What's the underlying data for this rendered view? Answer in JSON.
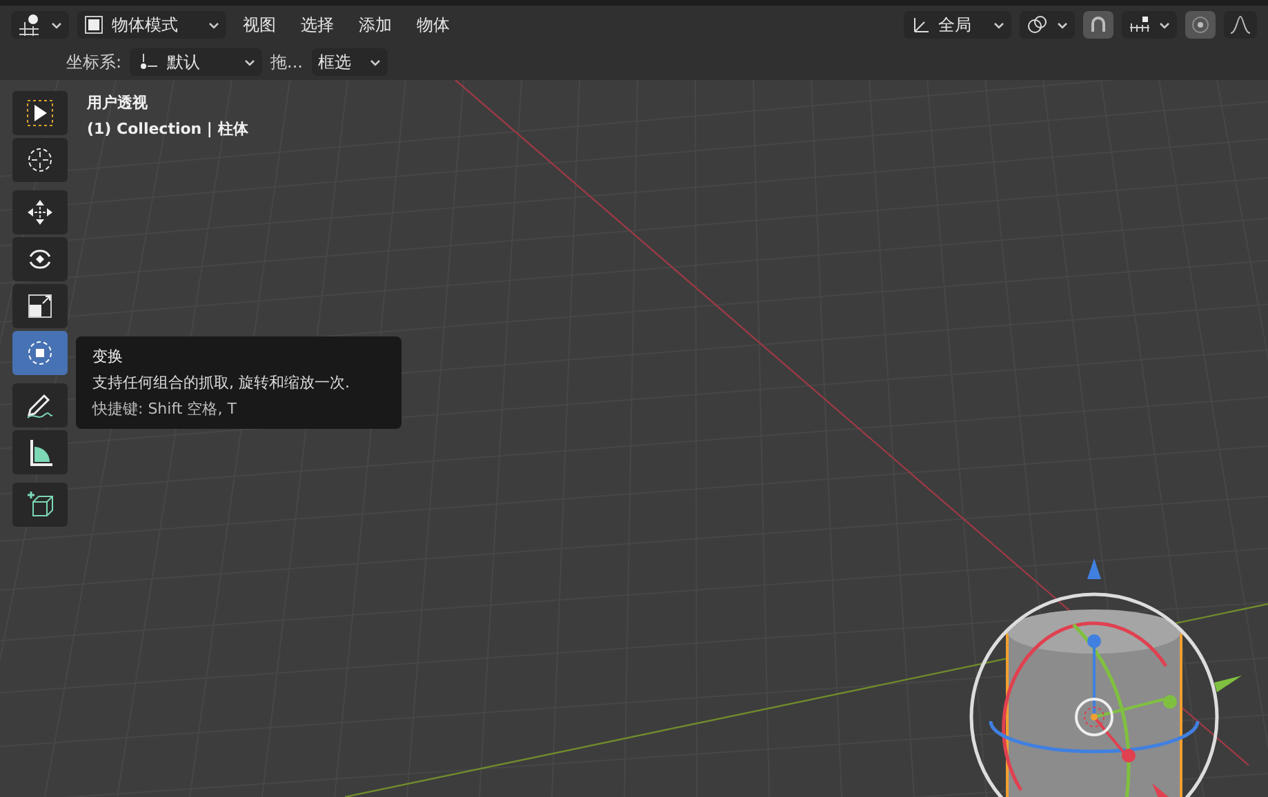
{
  "header": {
    "mode": {
      "label": "物体模式"
    },
    "menus": [
      "视图",
      "选择",
      "添加",
      "物体"
    ],
    "orientation": {
      "label": "全局"
    }
  },
  "tool_settings": {
    "coord_label": "坐标系:",
    "coord_value": "默认",
    "drag_label": "拖...",
    "drag_value": "框选"
  },
  "viewport": {
    "view_name": "用户透视",
    "collection": "(1) Collection | 柱体"
  },
  "tool_groups": [
    [
      {
        "kind": "select",
        "selected": false
      },
      {
        "kind": "cursor",
        "selected": false
      }
    ],
    [
      {
        "kind": "move",
        "selected": false
      },
      {
        "kind": "rotate",
        "selected": false
      },
      {
        "kind": "scale",
        "selected": false
      },
      {
        "kind": "transform",
        "selected": true
      }
    ],
    [
      {
        "kind": "annotate",
        "selected": false
      },
      {
        "kind": "measure",
        "selected": false
      }
    ],
    [
      {
        "kind": "add_cube",
        "selected": false
      }
    ]
  ],
  "tooltip": {
    "title": "变换",
    "description": "支持任何组合的抓取, 旋转和缩放一次.",
    "shortcut": "快捷键: Shift 空格, T"
  }
}
